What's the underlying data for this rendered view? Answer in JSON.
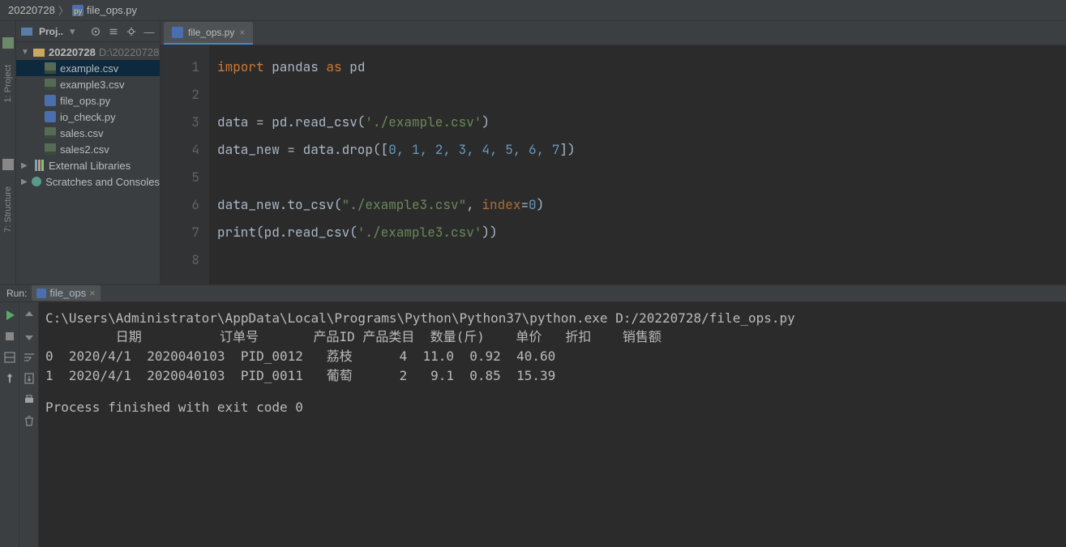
{
  "breadcrumb": {
    "root": "20220728",
    "file": "file_ops.py"
  },
  "sidebar_rails": {
    "project": "1: Project",
    "structure": "7: Structure"
  },
  "project": {
    "toolbar_title": "Proj..",
    "root": {
      "name": "20220728",
      "path": "D:\\20220728"
    },
    "files": [
      {
        "name": "example.csv",
        "type": "csv",
        "selected": true
      },
      {
        "name": "example3.csv",
        "type": "csv"
      },
      {
        "name": "file_ops.py",
        "type": "py"
      },
      {
        "name": "io_check.py",
        "type": "py"
      },
      {
        "name": "sales.csv",
        "type": "csv"
      },
      {
        "name": "sales2.csv",
        "type": "csv"
      }
    ],
    "external_libs": "External Libraries",
    "scratches": "Scratches and Consoles"
  },
  "editor": {
    "tab_title": "file_ops.py",
    "line_numbers": [
      "1",
      "2",
      "3",
      "4",
      "5",
      "6",
      "7",
      "8"
    ],
    "code": {
      "l1_import": "import",
      "l1_pandas": " pandas ",
      "l1_as": "as",
      "l1_pd": " pd",
      "l3_a": "data = pd.read_csv(",
      "l3_str": "'./example.csv'",
      "l3_b": ")",
      "l4_a": "data_new = data.drop([",
      "l4_nums": "0, 1, 2, 3, 4, 5, 6, 7",
      "l4_b": "])",
      "l6_a": "data_new.to_csv(",
      "l6_s1": "\"./example3.csv\"",
      "l6_b": ", ",
      "l6_p": "index",
      "l6_c": "=",
      "l6_n": "0",
      "l6_d": ")",
      "l7_a": "print(pd.read_csv(",
      "l7_s": "'./example3.csv'",
      "l7_b": "))"
    }
  },
  "run": {
    "label": "Run:",
    "tab": "file_ops",
    "output": {
      "cmd": "C:\\Users\\Administrator\\AppData\\Local\\Programs\\Python\\Python37\\python.exe D:/20220728/file_ops.py",
      "header": "         日期          订单号       产品ID 产品类目  数量(斤)    单价   折扣    销售额",
      "row0": "0  2020/4/1  2020040103  PID_0012   荔枝      4  11.0  0.92  40.60",
      "row1": "1  2020/4/1  2020040103  PID_0011   葡萄      2   9.1  0.85  15.39",
      "footer": "Process finished with exit code 0"
    }
  },
  "chart_data": {
    "type": "table",
    "title": "",
    "columns": [
      "",
      "日期",
      "订单号",
      "产品ID",
      "产品类目",
      "数量(斤)",
      "单价",
      "折扣",
      "销售额"
    ],
    "rows": [
      [
        0,
        "2020/4/1",
        "2020040103",
        "PID_0012",
        "荔枝",
        4,
        11.0,
        0.92,
        40.6
      ],
      [
        1,
        "2020/4/1",
        "2020040103",
        "PID_0011",
        "葡萄",
        2,
        9.1,
        0.85,
        15.39
      ]
    ]
  }
}
